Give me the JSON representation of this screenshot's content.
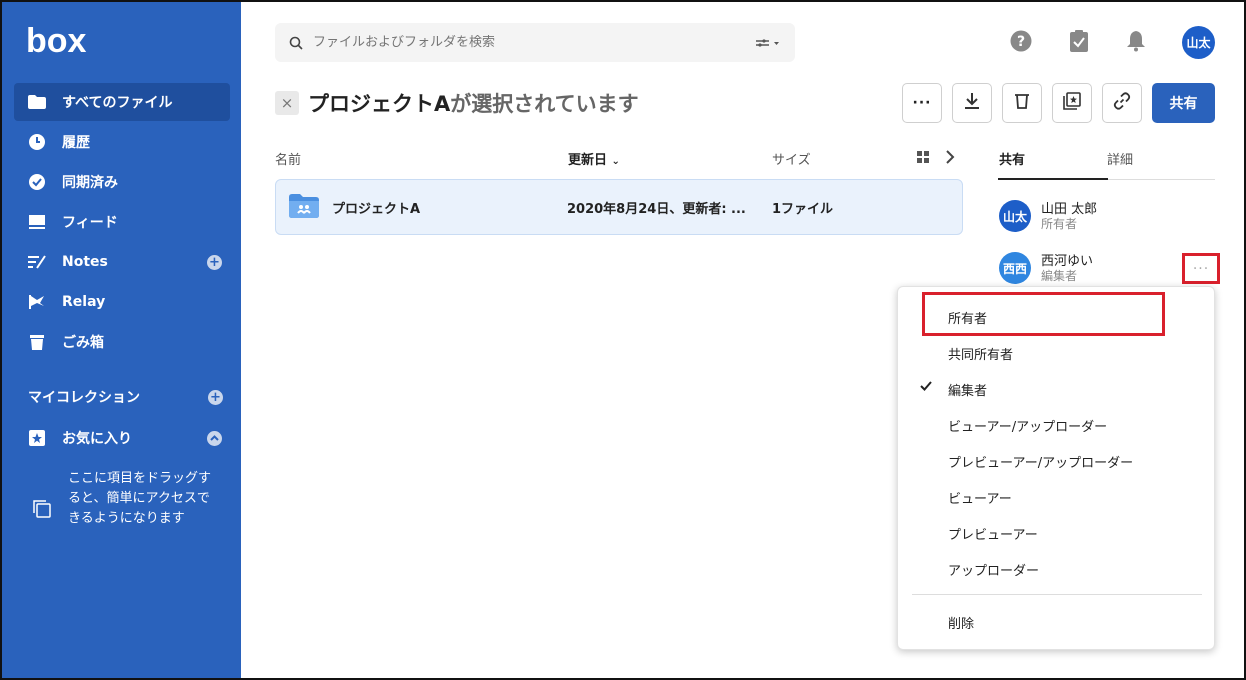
{
  "brand": "box",
  "sidebar": {
    "items": [
      {
        "label": "すべてのファイル",
        "icon": "folder-icon"
      },
      {
        "label": "履歴",
        "icon": "clock-icon"
      },
      {
        "label": "同期済み",
        "icon": "check-circle-icon"
      },
      {
        "label": "フィード",
        "icon": "feed-icon"
      },
      {
        "label": "Notes",
        "icon": "notes-icon"
      },
      {
        "label": "Relay",
        "icon": "relay-icon"
      },
      {
        "label": "ごみ箱",
        "icon": "trash-icon"
      }
    ],
    "collections_title": "マイコレクション",
    "favorites_label": "お気に入り",
    "drop_hint": "ここに項目をドラッグすると、簡単にアクセスできるようになります"
  },
  "search": {
    "placeholder": "ファイルおよびフォルダを検索"
  },
  "user": {
    "initials": "山太"
  },
  "selection": {
    "name": "プロジェクトA",
    "suffix": "が選択されています"
  },
  "actions": {
    "share_label": "共有"
  },
  "table": {
    "headers": {
      "name": "名前",
      "updated": "更新日",
      "size": "サイズ"
    },
    "rows": [
      {
        "name": "プロジェクトA",
        "updated": "2020年8月24日、更新者: ...",
        "size": "1ファイル"
      }
    ]
  },
  "panel": {
    "tabs": [
      "共有",
      "詳細"
    ],
    "collaborators": [
      {
        "initials": "山太",
        "name": "山田 太郎",
        "role": "所有者",
        "color": "#1d5ec8"
      },
      {
        "initials": "西西",
        "name": "西河ゆい",
        "role": "編集者",
        "color": "#2f86e0"
      }
    ],
    "more_label": "···"
  },
  "menu": {
    "items": [
      "所有者",
      "共同所有者",
      "編集者",
      "ビューアー/アップローダー",
      "プレビューアー/アップローダー",
      "ビューアー",
      "プレビューアー",
      "アップローダー"
    ],
    "checked_index": 2,
    "delete_label": "削除"
  },
  "colors": {
    "sidebar": "#2a62bc",
    "accent": "#2a62bc",
    "highlight": "#d9202c"
  }
}
